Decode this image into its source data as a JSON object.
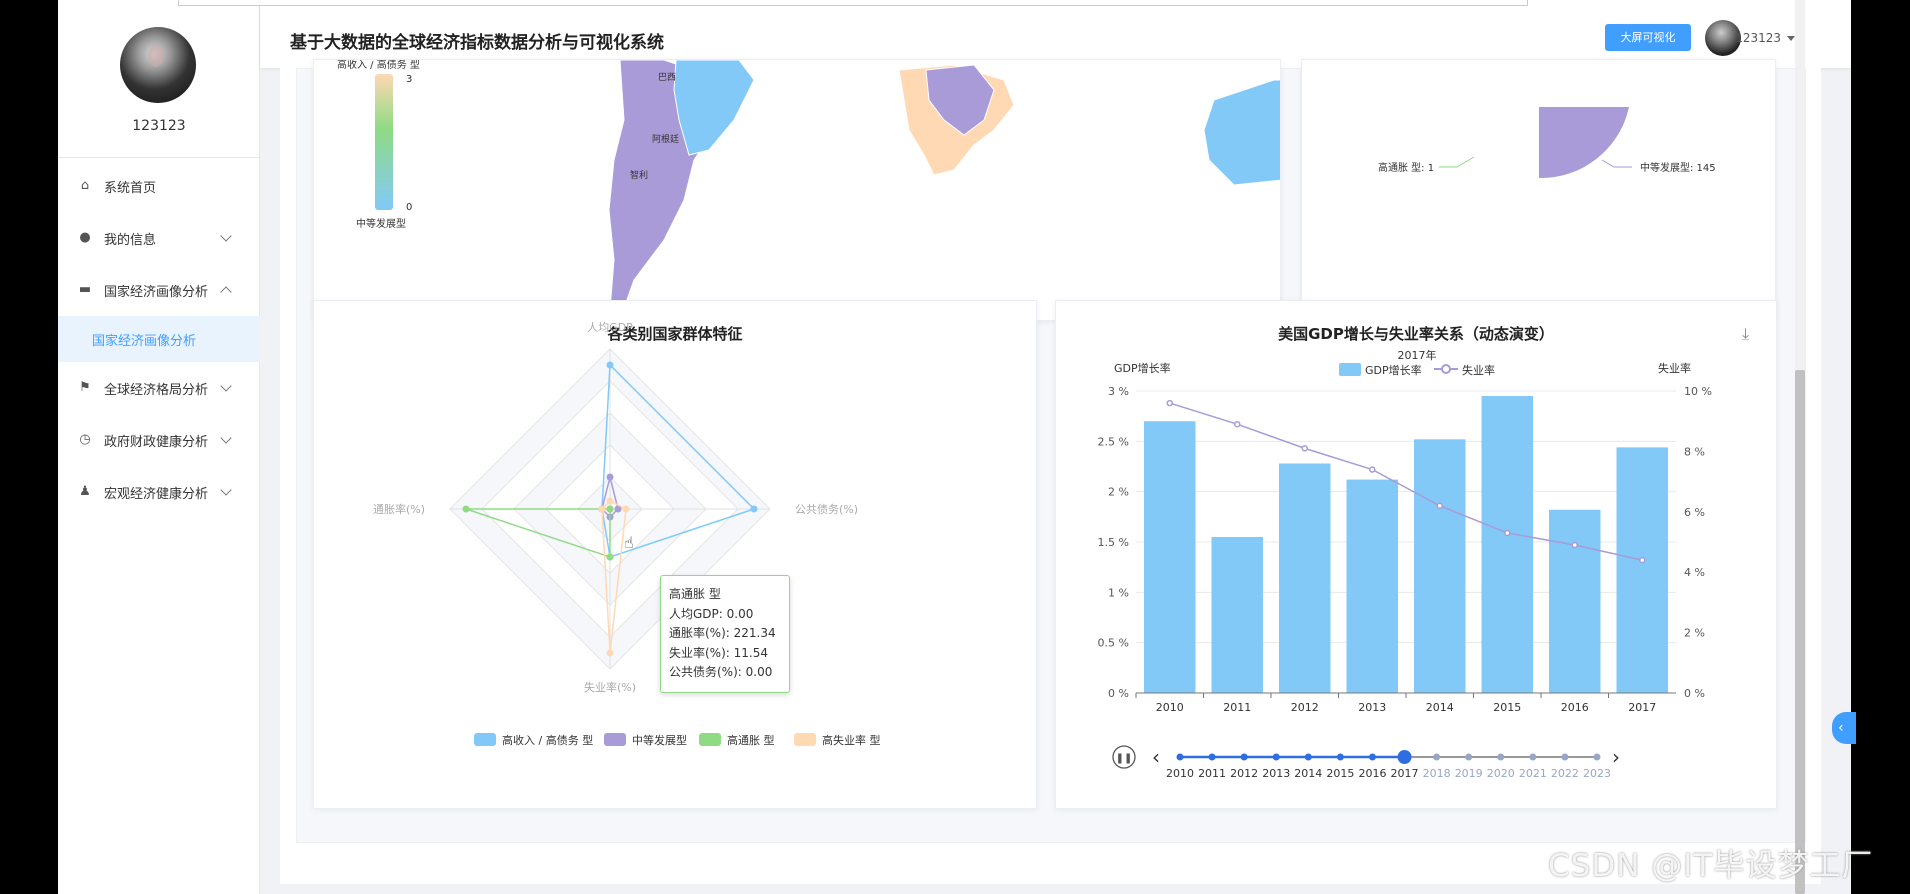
{
  "app": {
    "title": "基于大数据的全球经济指标数据分析与可视化系统",
    "bigscreen_btn": "大屏可视化",
    "username": "123123"
  },
  "sidebar": {
    "username": "123123",
    "items": [
      {
        "label": "系统首页",
        "icon": "home-icon"
      },
      {
        "label": "我的信息",
        "icon": "user-icon"
      },
      {
        "label": "国家经济画像分析",
        "icon": "briefcase-icon",
        "expanded": true,
        "sub": "国家经济画像分析"
      },
      {
        "label": "全球经济格局分析",
        "icon": "flag-icon"
      },
      {
        "label": "政府财政健康分析",
        "icon": "clock-icon"
      },
      {
        "label": "宏观经济健康分析",
        "icon": "person-icon"
      }
    ]
  },
  "map": {
    "legend_top": "高收入 / 高债务 型",
    "legend_max": "3",
    "legend_min": "0",
    "legend_bottom": "中等发展型",
    "labels": [
      "巴西",
      "智利",
      "阿根廷"
    ]
  },
  "pie": {
    "label1": "高通胀 型: 1",
    "label2": "中等发展型: 145"
  },
  "radar": {
    "title": "各类别国家群体特征",
    "axes": [
      "人均GDP",
      "公共债务(%)",
      "失业率(%)",
      "通胀率(%)"
    ],
    "legend": [
      "高收入 / 高债务 型",
      "中等发展型",
      "高通胀 型",
      "高失业率 型"
    ],
    "tooltip": {
      "title": "高通胀 型",
      "lines": [
        "人均GDP: 0.00",
        "通胀率(%): 221.34",
        "失业率(%): 11.54",
        "公共债务(%): 0.00"
      ]
    }
  },
  "combo": {
    "title": "美国GDP增长与失业率关系（动态演变）",
    "subtitle": "2017年",
    "left_axis_name": "GDP增长率",
    "right_axis_name": "失业率",
    "legend": [
      "GDP增长率",
      "失业率"
    ]
  },
  "timeline": {
    "years": [
      "2010",
      "2011",
      "2012",
      "2013",
      "2014",
      "2015",
      "2016",
      "2017",
      "2018",
      "2019",
      "2020",
      "2021",
      "2022",
      "2023"
    ],
    "current": "2017"
  },
  "colors": {
    "accent": "#409eff",
    "bar": "#82c9f8",
    "line": "#a99ad8",
    "green": "#8fdb84",
    "peach": "#ffd8b4",
    "purple": "#a99ad8"
  },
  "watermark": "CSDN @IT毕设梦工厂",
  "chart_data": [
    {
      "type": "bar",
      "title": "美国GDP增长与失业率关系（动态演变）",
      "subtitle": "2017年",
      "categories": [
        "2010",
        "2011",
        "2012",
        "2013",
        "2014",
        "2015",
        "2016",
        "2017"
      ],
      "series": [
        {
          "name": "GDP增长率",
          "type": "bar",
          "values": [
            2.7,
            1.55,
            2.28,
            2.12,
            2.52,
            2.95,
            1.82,
            2.44
          ]
        },
        {
          "name": "失业率",
          "type": "line",
          "values": [
            9.6,
            8.9,
            8.1,
            7.4,
            6.2,
            5.3,
            4.9,
            4.4
          ]
        }
      ],
      "ylabel": "GDP增长率",
      "ylim": [
        0,
        3
      ],
      "y2label": "失业率",
      "y2lim": [
        0,
        10
      ],
      "yticks": [
        "0 %",
        "0.5 %",
        "1 %",
        "1.5 %",
        "2 %",
        "2.5 %",
        "3 %"
      ],
      "y2ticks": [
        "0 %",
        "2 %",
        "4 %",
        "6 %",
        "8 %",
        "10 %"
      ]
    },
    {
      "type": "radar",
      "title": "各类别国家群体特征",
      "axes": [
        "人均GDP",
        "公共债务(%)",
        "失业率(%)",
        "通胀率(%)"
      ],
      "series": [
        {
          "name": "高收入 / 高债务 型",
          "values": [
            0.9,
            0.9,
            0.3,
            0.05
          ]
        },
        {
          "name": "中等发展型",
          "values": [
            0.2,
            0.05,
            0.05,
            0.05
          ]
        },
        {
          "name": "高通胀 型",
          "values": [
            0.0,
            0.0,
            0.3,
            0.9
          ]
        },
        {
          "name": "高失业率 型",
          "values": [
            0.05,
            0.1,
            0.9,
            0.05
          ]
        }
      ]
    }
  ]
}
